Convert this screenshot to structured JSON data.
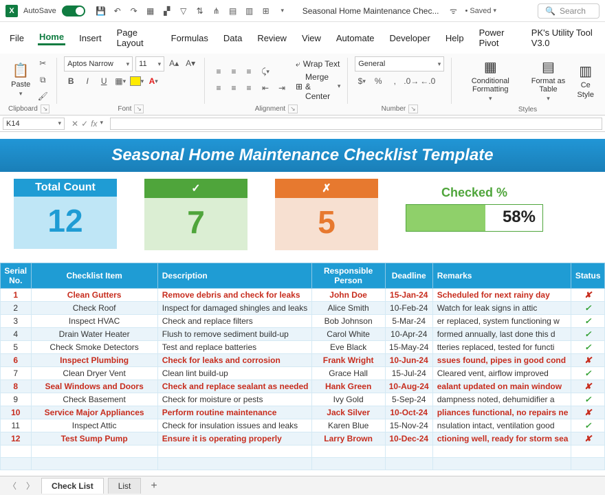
{
  "titlebar": {
    "autosave": "AutoSave",
    "doc_title": "Seasonal Home Maintenance Chec...",
    "saved": "Saved",
    "search_placeholder": "Search"
  },
  "menu": [
    "File",
    "Home",
    "Insert",
    "Page Layout",
    "Formulas",
    "Data",
    "Review",
    "View",
    "Automate",
    "Developer",
    "Help",
    "Power Pivot",
    "PK's Utility Tool V3.0"
  ],
  "ribbon": {
    "paste": "Paste",
    "clipboard": "Clipboard",
    "font_name": "Aptos Narrow",
    "font_size": "11",
    "font_group": "Font",
    "wrap": "Wrap Text",
    "merge": "Merge & Center",
    "alignment": "Alignment",
    "num_format": "General",
    "number": "Number",
    "cond_fmt": "Conditional Formatting",
    "fmt_table": "Format as Table",
    "cell_styles_1": "Ce",
    "cell_styles_2": "Style",
    "styles": "Styles"
  },
  "namebox": "K14",
  "banner": "Seasonal Home Maintenance Checklist Template",
  "kpi": {
    "total_label": "Total Count",
    "total_value": "12",
    "check_symbol": "✓",
    "check_value": "7",
    "cross_symbol": "✗",
    "cross_value": "5",
    "pct_label": "Checked %",
    "pct_value": "58%",
    "pct_fill_width": "58%"
  },
  "table": {
    "headers": [
      "Serial No.",
      "Checklist Item",
      "Description",
      "Responsible Person",
      "Deadline",
      "Remarks",
      "Status"
    ]
  },
  "chart_data": {
    "type": "table",
    "columns": [
      "serial",
      "item",
      "description",
      "responsible",
      "deadline",
      "remarks",
      "status",
      "flagged"
    ],
    "rows": [
      {
        "serial": "1",
        "item": "Clean Gutters",
        "description": "Remove debris and check for leaks",
        "responsible": "John Doe",
        "deadline": "15-Jan-24",
        "remarks": "Scheduled for next rainy day",
        "status": "✘",
        "flagged": true
      },
      {
        "serial": "2",
        "item": "Check Roof",
        "description": "Inspect for damaged shingles and leaks",
        "responsible": "Alice Smith",
        "deadline": "10-Feb-24",
        "remarks": "Watch for leak signs in attic",
        "status": "✓",
        "flagged": false
      },
      {
        "serial": "3",
        "item": "Inspect HVAC",
        "description": "Check and replace filters",
        "responsible": "Bob Johnson",
        "deadline": "5-Mar-24",
        "remarks": "er replaced, system functioning w",
        "status": "✓",
        "flagged": false
      },
      {
        "serial": "4",
        "item": "Drain Water Heater",
        "description": "Flush to remove sediment build-up",
        "responsible": "Carol White",
        "deadline": "10-Apr-24",
        "remarks": "formed annually, last done this d",
        "status": "✓",
        "flagged": false
      },
      {
        "serial": "5",
        "item": "Check Smoke Detectors",
        "description": "Test and replace batteries",
        "responsible": "Eve Black",
        "deadline": "15-May-24",
        "remarks": "tteries replaced, tested for functi",
        "status": "✓",
        "flagged": false
      },
      {
        "serial": "6",
        "item": "Inspect Plumbing",
        "description": "Check for leaks and corrosion",
        "responsible": "Frank Wright",
        "deadline": "10-Jun-24",
        "remarks": "ssues found, pipes in good cond",
        "status": "✘",
        "flagged": true
      },
      {
        "serial": "7",
        "item": "Clean Dryer Vent",
        "description": "Clean lint build-up",
        "responsible": "Grace Hall",
        "deadline": "15-Jul-24",
        "remarks": "Cleared vent, airflow improved",
        "status": "✓",
        "flagged": false
      },
      {
        "serial": "8",
        "item": "Seal Windows and Doors",
        "description": "Check and replace sealant as needed",
        "responsible": "Hank Green",
        "deadline": "10-Aug-24",
        "remarks": "ealant updated on main window",
        "status": "✘",
        "flagged": true
      },
      {
        "serial": "9",
        "item": "Check Basement",
        "description": "Check for moisture or pests",
        "responsible": "Ivy Gold",
        "deadline": "5-Sep-24",
        "remarks": "dampness noted, dehumidifier a",
        "status": "✓",
        "flagged": false
      },
      {
        "serial": "10",
        "item": "Service Major Appliances",
        "description": "Perform routine maintenance",
        "responsible": "Jack Silver",
        "deadline": "10-Oct-24",
        "remarks": "pliances functional, no repairs ne",
        "status": "✘",
        "flagged": true
      },
      {
        "serial": "11",
        "item": "Inspect Attic",
        "description": "Check for insulation issues and leaks",
        "responsible": "Karen Blue",
        "deadline": "15-Nov-24",
        "remarks": "nsulation intact, ventilation good",
        "status": "✓",
        "flagged": false
      },
      {
        "serial": "12",
        "item": "Test Sump Pump",
        "description": "Ensure it is operating properly",
        "responsible": "Larry Brown",
        "deadline": "10-Dec-24",
        "remarks": "ctioning well, ready for storm sea",
        "status": "✘",
        "flagged": true
      }
    ]
  },
  "sheet_tabs": {
    "active": "Check List",
    "other": "List"
  }
}
